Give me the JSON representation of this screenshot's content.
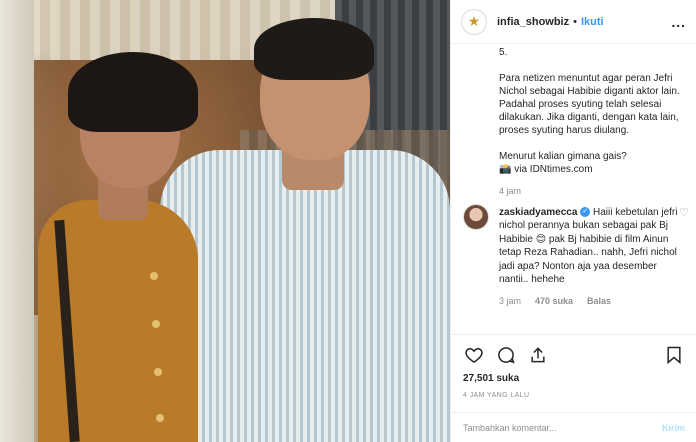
{
  "post": {
    "username": "infia_showbiz",
    "separator": "•",
    "follow_label": "Ikuti",
    "more_label": "...",
    "caption_top": "5.",
    "caption_p1": "Para netizen menuntut agar peran Jefri Nichol sebagai Habibie diganti aktor lain. Padahal proses syuting telah selesai dilakukan. Jika diganti, dengan kata lain, proses syuting harus diulang.",
    "caption_p2": "Menurut kalian gimana gais?",
    "caption_p3": "📸 via IDNtimes.com",
    "caption_time": "4 jam"
  },
  "comment": {
    "username": "zaskiadyamecca",
    "verified_glyph": "✓",
    "text": "Haiii kebetulan jefri nichol perannya bukan sebagai pak Bj Habibie 😊 pak Bj habibie di film Ainun tetap Reza Rahadian.. nahh, Jefri nichol jadi apa? Nonton aja yaa desember nantii.. hehehe",
    "time": "3 jam",
    "likes": "470 suka",
    "reply_label": "Balas"
  },
  "actions": {
    "likes": "27,501 suka",
    "ago": "4 JAM YANG LALU"
  },
  "add_comment": {
    "placeholder": "Tambahkan komentar...",
    "send_label": "Kirim"
  },
  "colors": {
    "link_blue": "#3897f0",
    "muted": "#8e8e8e",
    "shirt_mustard": "#b97a2a"
  },
  "icons": [
    "star-logo-icon",
    "heart-icon",
    "comment-icon",
    "share-icon",
    "bookmark-icon",
    "verified-icon"
  ]
}
